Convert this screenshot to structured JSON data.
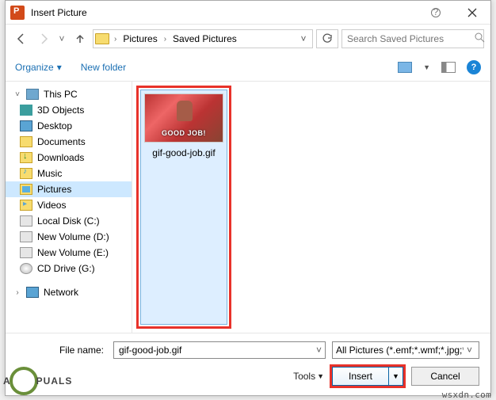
{
  "window": {
    "title": "Insert Picture"
  },
  "nav": {
    "breadcrumb": {
      "root_icon": "pictures-library-icon",
      "part1": "Pictures",
      "part2": "Saved Pictures"
    },
    "search_placeholder": "Search Saved Pictures"
  },
  "toolbar": {
    "organize": "Organize",
    "new_folder": "New folder"
  },
  "sidebar": {
    "this_pc": "This PC",
    "items": [
      "3D Objects",
      "Desktop",
      "Documents",
      "Downloads",
      "Music",
      "Pictures",
      "Videos",
      "Local Disk (C:)",
      "New Volume (D:)",
      "New Volume (E:)",
      "CD Drive (G:)"
    ],
    "network": "Network"
  },
  "file": {
    "thumb_caption": "GOOD JOB!",
    "name": "gif-good-job.gif"
  },
  "footer": {
    "filename_label": "File name:",
    "filename_value": "gif-good-job.gif",
    "filter": "All Pictures (*.emf;*.wmf;*.jpg;*",
    "tools": "Tools",
    "insert": "Insert",
    "cancel": "Cancel"
  },
  "watermark": "wsxdn.com",
  "brand": {
    "left": "A",
    "right": "PUALS"
  }
}
